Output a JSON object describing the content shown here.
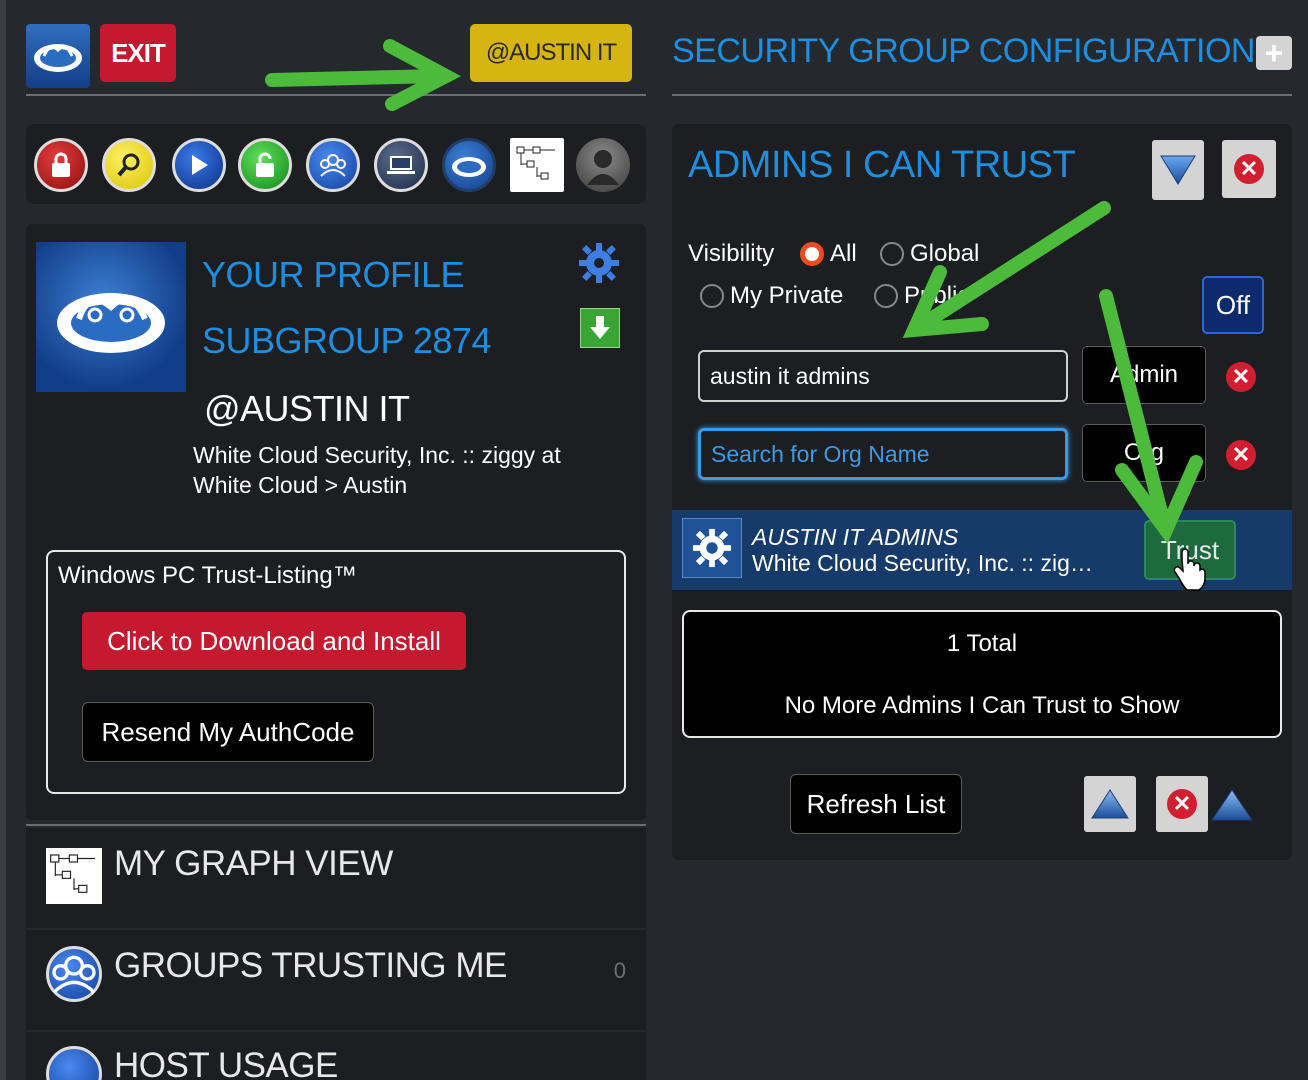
{
  "header": {
    "exit_label": "EXIT",
    "org_button_label": "@AUSTIN IT",
    "page_title": "SECURITY GROUP CONFIGURATION",
    "plus_label": "+"
  },
  "toolbar": {
    "icons": [
      "lock-red-icon",
      "search-yellow-icon",
      "play-icon",
      "unlock-green-icon",
      "groups-icon",
      "computer-icon",
      "cloud-icon",
      "graph-icon",
      "user-avatar-icon"
    ]
  },
  "profile": {
    "title": "YOUR PROFILE",
    "subgroup": "SUBGROUP 2874",
    "handle": "@AUSTIN IT",
    "description": "White Cloud Security, Inc. :: ziggy at White Cloud > Austin"
  },
  "trust_listing": {
    "heading": "Windows PC Trust-Listing™",
    "download_label": "Click to Download and Install",
    "resend_label": "Resend My AuthCode"
  },
  "nav": {
    "graph_view": "MY GRAPH VIEW",
    "groups_trusting": "GROUPS TRUSTING ME",
    "groups_trusting_count": "0",
    "host_usage": "HOST USAGE"
  },
  "admins": {
    "title": "ADMINS I CAN TRUST",
    "visibility_label": "Visibility",
    "radio_all": "All",
    "radio_global": "Global",
    "radio_private": "My Private",
    "radio_public": "Public",
    "selected_visibility": "All",
    "off_label": "Off",
    "name_value": "austin it admins",
    "admin_label": "Admin",
    "search_placeholder": "Search for Org Name",
    "org_label": "Org",
    "result_name": "AUSTIN IT ADMINS",
    "result_org": "White Cloud Security, Inc. :: zig…",
    "trust_label": "Trust",
    "total_label": "1 Total",
    "no_more_label": "No More Admins I Can Trust to Show",
    "refresh_label": "Refresh List"
  },
  "colors": {
    "accent_blue": "#1c8fe0",
    "exit_red": "#c4192f",
    "org_yellow": "#d6b412",
    "annotation_green": "#4cbb3c"
  }
}
